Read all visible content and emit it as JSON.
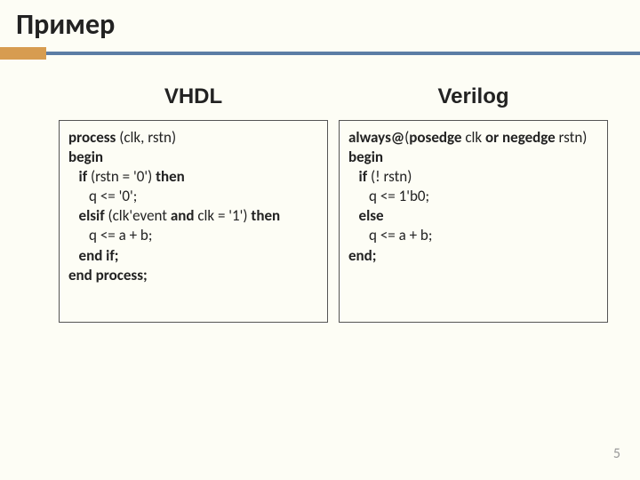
{
  "title": "Пример",
  "columns": {
    "left": {
      "header": "VHDL",
      "code": {
        "l1a": "process ",
        "l1b": "(clk, rstn)",
        "l2": "begin",
        "l3a": "   if ",
        "l3b": "(rstn = '0') ",
        "l3c": "then",
        "l4": "      q <= '0';",
        "l5a": "   elsif ",
        "l5b": "(clk'event ",
        "l5c": "and ",
        "l5d": "clk = '1') ",
        "l5e": "then",
        "l6": "      q <= a + b;",
        "l7": "   end if;",
        "l8": "end process;"
      }
    },
    "right": {
      "header": "Verilog",
      "code": {
        "l1a": "always@",
        "l1b": "(",
        "l1c": "posedge ",
        "l1d": "clk ",
        "l1e": "or negedge ",
        "l1f": "rstn)",
        "l2": "begin",
        "l3a": "   if ",
        "l3b": "(! rstn)",
        "l4": "      q <= 1'b0;",
        "l5": "   else",
        "l6": "      q <= a + b;",
        "l7": "end;"
      }
    }
  },
  "pageNumber": "5"
}
